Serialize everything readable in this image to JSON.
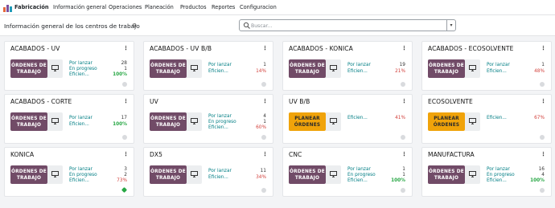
{
  "topbar": {
    "app_name": "Fabricación",
    "menu": [
      "Información general",
      "Operaciones",
      "Planeación",
      "Productos",
      "Reportes",
      "Configuracion"
    ]
  },
  "control": {
    "title": "Información general de los centros de trabajo",
    "search_placeholder": "Buscar..."
  },
  "colors": {
    "primary": "#714b67",
    "warning": "#f0a30a",
    "teal": "#017e84",
    "red": "#d23f3a",
    "green": "#28a745"
  },
  "workcenters": [
    {
      "name": "ACABADOS - UV",
      "button": [
        "ÓRDENES DE",
        "TRABAJO"
      ],
      "button_style": "primary",
      "stats": [
        {
          "label": "Por lanzar",
          "value": "28",
          "style": ""
        },
        {
          "label": "En progreso",
          "value": "1",
          "style": ""
        },
        {
          "label": "Eficien...",
          "value": "100%",
          "style": "green"
        }
      ],
      "status": "grey"
    },
    {
      "name": "ACABADOS - UV B/B",
      "button": [
        "ÓRDENES DE",
        "TRABAJO"
      ],
      "button_style": "primary",
      "stats": [
        {
          "label": "Por lanzar",
          "value": "1",
          "style": ""
        },
        {
          "label": "Eficien...",
          "value": "14%",
          "style": "red"
        }
      ],
      "status": "grey"
    },
    {
      "name": "ACABADOS - KONICA",
      "button": [
        "ÓRDENES DE",
        "TRABAJO"
      ],
      "button_style": "primary",
      "stats": [
        {
          "label": "Por lanzar",
          "value": "19",
          "style": ""
        },
        {
          "label": "Eficien...",
          "value": "21%",
          "style": "red"
        }
      ],
      "status": "grey"
    },
    {
      "name": "ACABADOS - ECOSOLVENTE",
      "button": [
        "ÓRDENES DE",
        "TRABAJO"
      ],
      "button_style": "primary",
      "stats": [
        {
          "label": "Por lanzar",
          "value": "1",
          "style": ""
        },
        {
          "label": "Eficien...",
          "value": "48%",
          "style": "red"
        }
      ],
      "status": "grey"
    },
    {
      "name": "ACABADOS - CORTE",
      "button": [
        "ÓRDENES DE",
        "TRABAJO"
      ],
      "button_style": "primary",
      "stats": [
        {
          "label": "Por lanzar",
          "value": "17",
          "style": ""
        },
        {
          "label": "Eficien...",
          "value": "100%",
          "style": "green"
        }
      ],
      "status": "grey"
    },
    {
      "name": "UV",
      "button": [
        "ÓRDENES DE",
        "TRABAJO"
      ],
      "button_style": "primary",
      "stats": [
        {
          "label": "Por lanzar",
          "value": "4",
          "style": ""
        },
        {
          "label": "En progreso",
          "value": "1",
          "style": ""
        },
        {
          "label": "Eficien...",
          "value": "60%",
          "style": "red"
        }
      ],
      "status": "grey"
    },
    {
      "name": "UV B/B",
      "button": [
        "PLANEAR",
        "ÓRDENES"
      ],
      "button_style": "warning",
      "stats": [
        {
          "label": "Eficien...",
          "value": "41%",
          "style": "red"
        }
      ],
      "status": "grey"
    },
    {
      "name": "ECOSOLVENTE",
      "button": [
        "PLANEAR",
        "ÓRDENES"
      ],
      "button_style": "warning",
      "stats": [
        {
          "label": "Eficien...",
          "value": "67%",
          "style": "red"
        }
      ],
      "status": "grey"
    },
    {
      "name": "KONICA",
      "button": [
        "ÓRDENES DE",
        "TRABAJO"
      ],
      "button_style": "primary",
      "stats": [
        {
          "label": "Por lanzar",
          "value": "3",
          "style": ""
        },
        {
          "label": "En progreso",
          "value": "2",
          "style": ""
        },
        {
          "label": "Eficien...",
          "value": "73%",
          "style": "red"
        }
      ],
      "status": "green"
    },
    {
      "name": "DX5",
      "button": [
        "ÓRDENES DE",
        "TRABAJO"
      ],
      "button_style": "primary",
      "stats": [
        {
          "label": "Por lanzar",
          "value": "11",
          "style": ""
        },
        {
          "label": "Eficien...",
          "value": "34%",
          "style": "red"
        }
      ],
      "status": "grey"
    },
    {
      "name": "CNC",
      "button": [
        "ÓRDENES DE",
        "TRABAJO"
      ],
      "button_style": "primary",
      "stats": [
        {
          "label": "Por lanzar",
          "value": "1",
          "style": ""
        },
        {
          "label": "En progreso",
          "value": "1",
          "style": ""
        },
        {
          "label": "Eficien...",
          "value": "100%",
          "style": "green"
        }
      ],
      "status": "grey"
    },
    {
      "name": "MANUFACTURA",
      "button": [
        "ÓRDENES DE",
        "TRABAJO"
      ],
      "button_style": "primary",
      "stats": [
        {
          "label": "Por lanzar",
          "value": "16",
          "style": ""
        },
        {
          "label": "En progreso",
          "value": "4",
          "style": ""
        },
        {
          "label": "Eficien...",
          "value": "100%",
          "style": "green"
        }
      ],
      "status": "grey"
    }
  ]
}
